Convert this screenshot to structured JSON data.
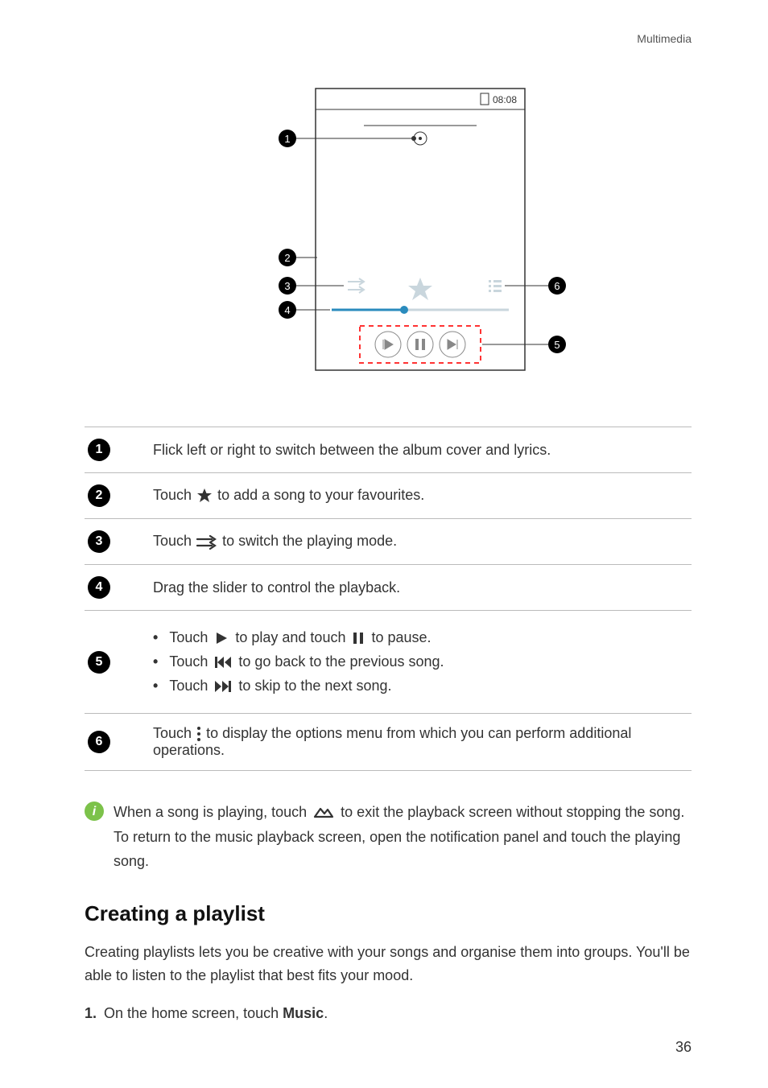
{
  "header": {
    "section": "Multimedia"
  },
  "diagram": {
    "time": "08:08",
    "callouts": [
      1,
      2,
      3,
      4,
      5,
      6
    ]
  },
  "rows": [
    {
      "num": 1,
      "text": "Flick left or right to switch between the album cover and lyrics."
    },
    {
      "num": 2,
      "before": "Touch ",
      "icon": "star-icon",
      "after": " to add a song to your favourites."
    },
    {
      "num": 3,
      "before": "Touch ",
      "icon": "shuffle-icon",
      "after": "to switch the playing mode."
    },
    {
      "num": 4,
      "text": "Drag the slider to control the playback."
    },
    {
      "num": 5,
      "bullets": [
        {
          "pieces": [
            "Touch ",
            {
              "icon": "play-icon"
            },
            " to play and touch  ",
            {
              "icon": "pause-icon"
            },
            "  to pause."
          ]
        },
        {
          "pieces": [
            "Touch ",
            {
              "icon": "prev-icon"
            },
            "to go back to the previous song."
          ]
        },
        {
          "pieces": [
            "Touch ",
            {
              "icon": "next-icon"
            },
            "to skip to the next song."
          ]
        }
      ]
    },
    {
      "num": 6,
      "before": "Touch   ",
      "icon": "kebab-icon",
      "after": "  to display the options menu from which you can perform additional operations."
    }
  ],
  "tip": {
    "before": "When a song is playing, touch ",
    "icon": "home-icon",
    "after": " to exit the playback screen without stopping the song. To return to the music playback screen, open the notification panel and touch the playing song."
  },
  "section2": {
    "title": "Creating a playlist"
  },
  "para1": "Creating playlists lets you be creative with your songs and organise them into groups. You'll be able to listen to the playlist that best fits your mood.",
  "step1": {
    "num": "1.",
    "before": "On the home screen, touch ",
    "bold": "Music",
    "after": "."
  },
  "page": "36"
}
